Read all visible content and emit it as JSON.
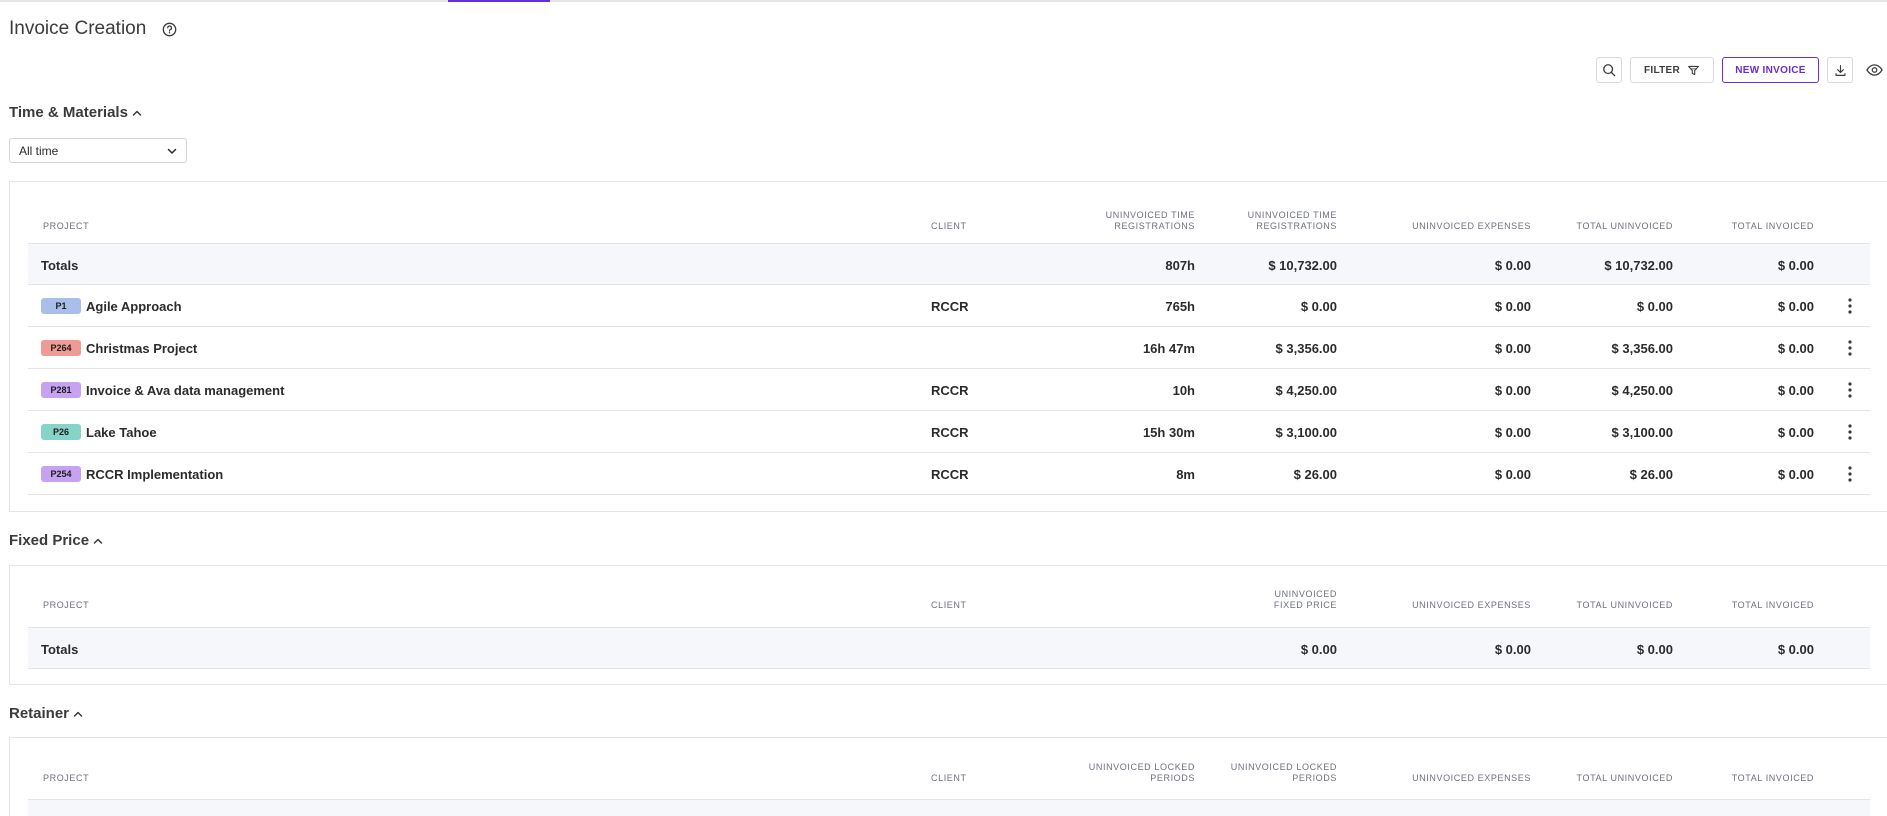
{
  "page": {
    "title": "Invoice Creation"
  },
  "toolbar": {
    "filter_label": "FILTER",
    "new_invoice_label": "NEW INVOICE"
  },
  "time_materials": {
    "title": "Time & Materials",
    "period_select": "All time",
    "headers": {
      "project": "PROJECT",
      "client": "CLIENT",
      "uninvoiced_time_hours": "UNINVOICED TIME REGISTRATIONS",
      "uninvoiced_time_amount": "UNINVOICED TIME REGISTRATIONS",
      "uninvoiced_expenses": "UNINVOICED EXPENSES",
      "total_uninvoiced": "TOTAL UNINVOICED",
      "total_invoiced": "TOTAL INVOICED"
    },
    "totals": {
      "label": "Totals",
      "hours": "807h",
      "time_amount": "$ 10,732.00",
      "expenses": "$ 0.00",
      "total_uninvoiced": "$ 10,732.00",
      "total_invoiced": "$ 0.00"
    },
    "rows": [
      {
        "badge": "P1",
        "badge_color": "#a9bfea",
        "name": "Agile Approach",
        "client": "RCCR",
        "hours": "765h",
        "time_amount": "$ 0.00",
        "expenses": "$ 0.00",
        "total_uninvoiced": "$ 0.00",
        "total_invoiced": "$ 0.00"
      },
      {
        "badge": "P264",
        "badge_color": "#f09a96",
        "name": "Christmas Project",
        "client": "",
        "hours": "16h 47m",
        "time_amount": "$ 3,356.00",
        "expenses": "$ 0.00",
        "total_uninvoiced": "$ 3,356.00",
        "total_invoiced": "$ 0.00"
      },
      {
        "badge": "P281",
        "badge_color": "#c6a2f0",
        "name": "Invoice & Ava data management",
        "client": "RCCR",
        "hours": "10h",
        "time_amount": "$ 4,250.00",
        "expenses": "$ 0.00",
        "total_uninvoiced": "$ 4,250.00",
        "total_invoiced": "$ 0.00"
      },
      {
        "badge": "P26",
        "badge_color": "#86d3c7",
        "name": "Lake Tahoe",
        "client": "RCCR",
        "hours": "15h 30m",
        "time_amount": "$ 3,100.00",
        "expenses": "$ 0.00",
        "total_uninvoiced": "$ 3,100.00",
        "total_invoiced": "$ 0.00"
      },
      {
        "badge": "P254",
        "badge_color": "#c6a2f0",
        "name": "RCCR Implementation",
        "client": "RCCR",
        "hours": "8m",
        "time_amount": "$ 26.00",
        "expenses": "$ 0.00",
        "total_uninvoiced": "$ 26.00",
        "total_invoiced": "$ 0.00"
      }
    ]
  },
  "fixed_price": {
    "title": "Fixed Price",
    "headers": {
      "project": "PROJECT",
      "client": "CLIENT",
      "uninvoiced_fixed_price": "UNINVOICED FIXED PRICE",
      "uninvoiced_expenses": "UNINVOICED EXPENSES",
      "total_uninvoiced": "TOTAL UNINVOICED",
      "total_invoiced": "TOTAL INVOICED"
    },
    "totals": {
      "label": "Totals",
      "fixed_price": "$ 0.00",
      "expenses": "$ 0.00",
      "total_uninvoiced": "$ 0.00",
      "total_invoiced": "$ 0.00"
    }
  },
  "retainer": {
    "title": "Retainer",
    "headers": {
      "project": "PROJECT",
      "client": "CLIENT",
      "uninvoiced_locked_periods_1": "UNINVOICED LOCKED PERIODS",
      "uninvoiced_locked_periods_2": "UNINVOICED LOCKED PERIODS",
      "uninvoiced_expenses": "UNINVOICED EXPENSES",
      "total_uninvoiced": "TOTAL UNINVOICED",
      "total_invoiced": "TOTAL INVOICED"
    }
  },
  "colors": {
    "accent": "#6a2bd9",
    "border": "#e4e4e8",
    "totals_bg": "#f6f7fa"
  }
}
